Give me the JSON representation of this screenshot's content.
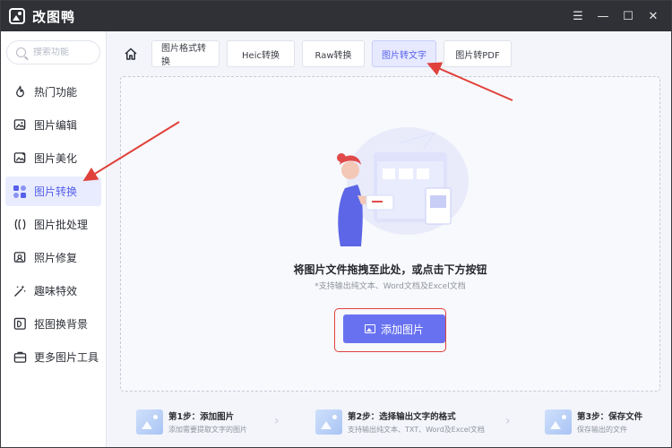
{
  "window": {
    "title": "改图鸭",
    "controls": {
      "menu": "☰",
      "minimize": "—",
      "maximize": "☐",
      "close": "✕"
    }
  },
  "sidebar": {
    "search_placeholder": "搜索功能",
    "items": [
      {
        "label": "热门功能",
        "icon": "flame-icon",
        "active": false
      },
      {
        "label": "图片编辑",
        "icon": "image-edit-icon",
        "active": false
      },
      {
        "label": "图片美化",
        "icon": "image-beautify-icon",
        "active": false
      },
      {
        "label": "图片转换",
        "icon": "image-convert-icon",
        "active": true
      },
      {
        "label": "图片批处理",
        "icon": "batch-icon",
        "active": false
      },
      {
        "label": "照片修复",
        "icon": "photo-repair-icon",
        "active": false
      },
      {
        "label": "趣味特效",
        "icon": "effects-icon",
        "active": false
      },
      {
        "label": "抠图换背景",
        "icon": "cutout-icon",
        "active": false
      },
      {
        "label": "更多图片工具",
        "icon": "toolbox-icon",
        "active": false
      }
    ]
  },
  "tabs": [
    {
      "label": "图片格式转换",
      "active": false
    },
    {
      "label": "Heic转换",
      "active": false
    },
    {
      "label": "Raw转换",
      "active": false
    },
    {
      "label": "图片转文字",
      "active": true
    },
    {
      "label": "图片转PDF",
      "active": false
    }
  ],
  "dropzone": {
    "title": "将图片文件拖拽至此处，或点击下方按钮",
    "subtitle": "*支持输出纯文本、Word文档及Excel文档",
    "button_label": "添加图片"
  },
  "steps": [
    {
      "title": "第1步：添加图片",
      "desc": "添加需要提取文字的图片"
    },
    {
      "title": "第2步：选择输出文字的格式",
      "desc": "支持输出纯文本、TXT、Word及Excel文档"
    },
    {
      "title": "第3步：保存文件",
      "desc": "保存输出的文件"
    }
  ],
  "colors": {
    "accent": "#6872f0",
    "annotation": "#e0413b",
    "titlebar": "#2f3136"
  }
}
